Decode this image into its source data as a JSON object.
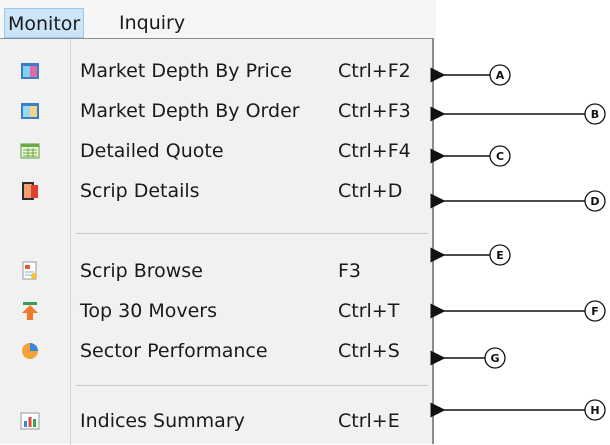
{
  "menubar": {
    "items": [
      {
        "label": "Monitor"
      },
      {
        "label": "Inquiry"
      }
    ]
  },
  "menu": {
    "groups": [
      [
        {
          "icon": "market-depth-price-icon",
          "label": "Market Depth By Price",
          "shortcut": "Ctrl+F2",
          "callout": "A"
        },
        {
          "icon": "market-depth-order-icon",
          "label": "Market Depth By Order",
          "shortcut": "Ctrl+F3",
          "callout": "B"
        },
        {
          "icon": "detailed-quote-icon",
          "label": "Detailed Quote",
          "shortcut": "Ctrl+F4",
          "callout": "C"
        },
        {
          "icon": "scrip-details-icon",
          "label": "Scrip Details",
          "shortcut": "Ctrl+D",
          "callout": "D"
        }
      ],
      [
        {
          "icon": "scrip-browse-icon",
          "label": "Scrip Browse",
          "shortcut": "F3",
          "callout": "E"
        },
        {
          "icon": "top-movers-icon",
          "label": "Top 30 Movers",
          "shortcut": "Ctrl+T",
          "callout": "F"
        },
        {
          "icon": "sector-performance-icon",
          "label": "Sector Performance",
          "shortcut": "Ctrl+S",
          "callout": "G"
        }
      ],
      [
        {
          "icon": "indices-summary-icon",
          "label": "Indices Summary",
          "shortcut": "Ctrl+E",
          "callout": "H"
        }
      ]
    ]
  },
  "colors": {
    "menubar_active_bg": "#cce4f7",
    "menu_bg": "#f1f1f1"
  }
}
